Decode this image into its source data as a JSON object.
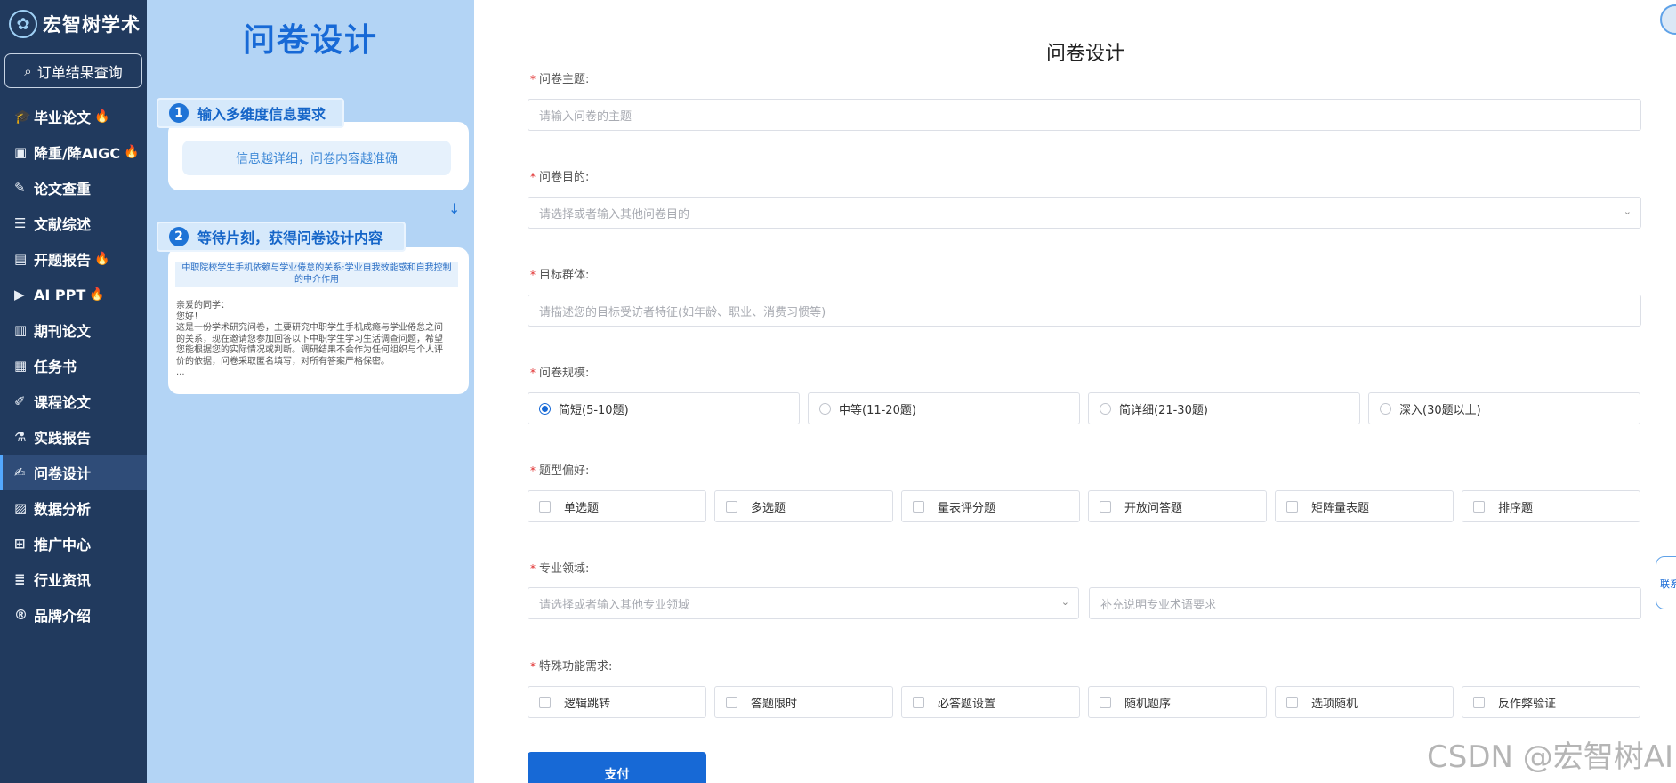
{
  "brand": {
    "name": "宏智树学术",
    "logo_icon": "tree-logo-icon"
  },
  "sidebar": {
    "query_button": "订单结果查询",
    "items": [
      {
        "label": "毕业论文",
        "icon": "graduation-cap-icon",
        "hot": true
      },
      {
        "label": "降重/降AIGC",
        "icon": "bus-icon",
        "hot": true
      },
      {
        "label": "论文查重",
        "icon": "doc-edit-icon",
        "hot": false
      },
      {
        "label": "文献综述",
        "icon": "list-icon",
        "hot": false
      },
      {
        "label": "开题报告",
        "icon": "report-icon",
        "hot": true
      },
      {
        "label": "AI PPT",
        "icon": "ppt-icon",
        "hot": true
      },
      {
        "label": "期刊论文",
        "icon": "journal-icon",
        "hot": false
      },
      {
        "label": "任务书",
        "icon": "book-icon",
        "hot": false
      },
      {
        "label": "课程论文",
        "icon": "course-icon",
        "hot": false
      },
      {
        "label": "实践报告",
        "icon": "practice-icon",
        "hot": false
      },
      {
        "label": "问卷设计",
        "icon": "survey-icon",
        "hot": false,
        "active": true
      },
      {
        "label": "数据分析",
        "icon": "chart-icon",
        "hot": false
      },
      {
        "label": "推广中心",
        "icon": "grid-icon",
        "hot": false
      },
      {
        "label": "行业资讯",
        "icon": "news-icon",
        "hot": false
      },
      {
        "label": "品牌介绍",
        "icon": "registered-icon",
        "hot": false
      }
    ]
  },
  "guide": {
    "title": "问卷设计",
    "step1": {
      "num": "1",
      "label": "输入多维度信息要求",
      "hint": "信息越详细，问卷内容越准确"
    },
    "step2": {
      "num": "2",
      "label": "等待片刻，获得问卷设计内容"
    },
    "preview": {
      "title": "中职院校学生手机依赖与学业倦怠的关系:学业自我效能感和自我控制的中介作用",
      "lines": [
        "亲爱的同学：",
        "您好！",
        "这是一份学术研究问卷，主要研究中职学生手机成瘾与学业倦怠之间",
        "的关系，现在邀请您参加回答以下中职学生学习生活调查问题，希望",
        "您能根据您的实际情况或判断。调研结果不会作为任何组织与个人评",
        "价的依据，问卷采取匿名填写，对所有答案严格保密。",
        "..."
      ]
    }
  },
  "form": {
    "title": "问卷设计",
    "topic": {
      "label": "问卷主题:",
      "placeholder": "请输入问卷的主题"
    },
    "purpose": {
      "label": "问卷目的:",
      "placeholder": "请选择或者输入其他问卷目的"
    },
    "audience": {
      "label": "目标群体:",
      "placeholder": "请描述您的目标受访者特征(如年龄、职业、消费习惯等)"
    },
    "scale": {
      "label": "问卷规模:",
      "options": [
        "简短(5-10题)",
        "中等(11-20题)",
        "简详细(21-30题)",
        "深入(30题以上)"
      ],
      "selected": 0
    },
    "qtypes": {
      "label": "题型偏好:",
      "options": [
        "单选题",
        "多选题",
        "量表评分题",
        "开放问答题",
        "矩阵量表题",
        "排序题"
      ]
    },
    "field": {
      "label": "专业领域:",
      "placeholder": "请选择或者输入其他专业领域",
      "extra_placeholder": "补充说明专业术语要求"
    },
    "special": {
      "label": "特殊功能需求:",
      "options": [
        "逻辑跳转",
        "答题限时",
        "必答题设置",
        "随机题序",
        "选项随机",
        "反作弊验证"
      ]
    },
    "pay_button": "支付"
  },
  "float": {
    "contact": "联系"
  },
  "watermark": "CSDN @宏智树AI"
}
